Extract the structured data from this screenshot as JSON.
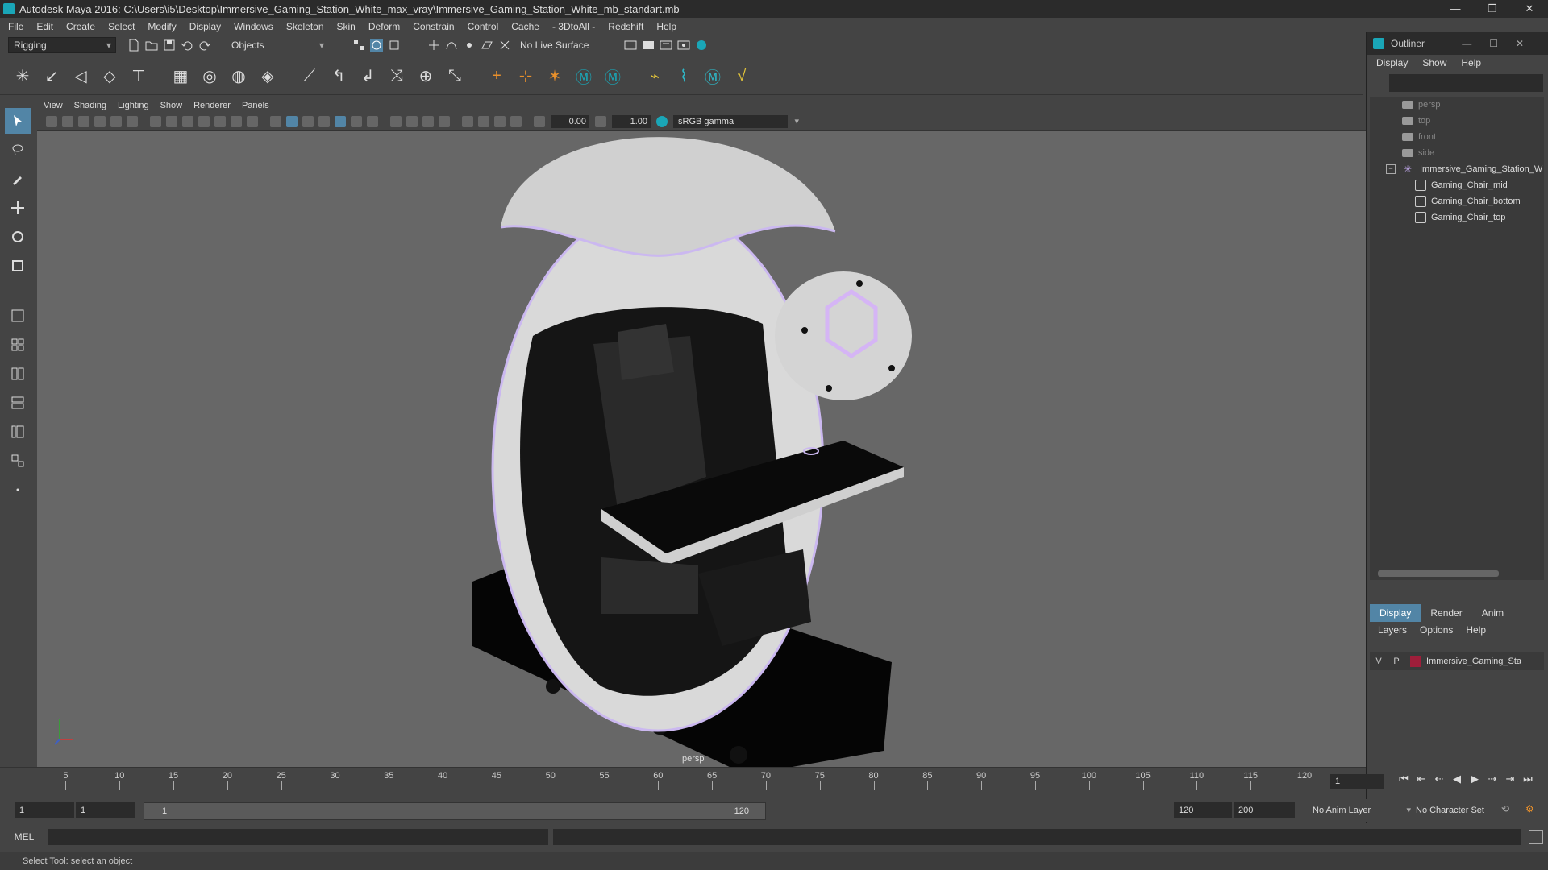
{
  "window": {
    "title": "Autodesk Maya 2016: C:\\Users\\i5\\Desktop\\Immersive_Gaming_Station_White_max_vray\\Immersive_Gaming_Station_White_mb_standart.mb",
    "minimize": "—",
    "restore": "❐",
    "close": "✕"
  },
  "menubar": [
    "File",
    "Edit",
    "Create",
    "Select",
    "Modify",
    "Display",
    "Windows",
    "Skeleton",
    "Skin",
    "Deform",
    "Constrain",
    "Control",
    "Cache",
    "- 3DtoAll -",
    "Redshift",
    "Help"
  ],
  "toolbar": {
    "mode": "Rigging",
    "selection_mode": "Objects",
    "live_surface": "No Live Surface"
  },
  "viewport": {
    "menu": [
      "View",
      "Shading",
      "Lighting",
      "Show",
      "Renderer",
      "Panels"
    ],
    "exposure": "0.00",
    "gamma_value": "1.00",
    "color_space": "sRGB gamma",
    "camera_label": "persp"
  },
  "outliner": {
    "title": "Outliner",
    "menu": [
      "Display",
      "Show",
      "Help"
    ],
    "items": [
      {
        "label": "persp",
        "type": "camera"
      },
      {
        "label": "top",
        "type": "camera"
      },
      {
        "label": "front",
        "type": "camera"
      },
      {
        "label": "side",
        "type": "camera"
      },
      {
        "label": "Immersive_Gaming_Station_W",
        "type": "group"
      },
      {
        "label": "Gaming_Chair_mid",
        "type": "mesh"
      },
      {
        "label": "Gaming_Chair_bottom",
        "type": "mesh"
      },
      {
        "label": "Gaming_Chair_top",
        "type": "mesh"
      }
    ]
  },
  "layers": {
    "tabs": [
      "Display",
      "Render",
      "Anim"
    ],
    "menu": [
      "Layers",
      "Options",
      "Help"
    ],
    "row": {
      "v": "V",
      "p": "P",
      "name": "Immersive_Gaming_Sta"
    }
  },
  "timeline": {
    "ticks": [
      1,
      5,
      10,
      15,
      20,
      25,
      30,
      35,
      40,
      45,
      50,
      55,
      60,
      65,
      70,
      75,
      80,
      85,
      90,
      95,
      100,
      105,
      110,
      115,
      120
    ],
    "current_frame": "1"
  },
  "range": {
    "start": "1",
    "playback_start": "1",
    "slider_start": "1",
    "slider_end": "120",
    "playback_end": "120",
    "end": "200",
    "anim_layer": "No Anim Layer",
    "character_set": "No Character Set"
  },
  "command": {
    "label": "MEL"
  },
  "help_line": "Select Tool: select an object"
}
